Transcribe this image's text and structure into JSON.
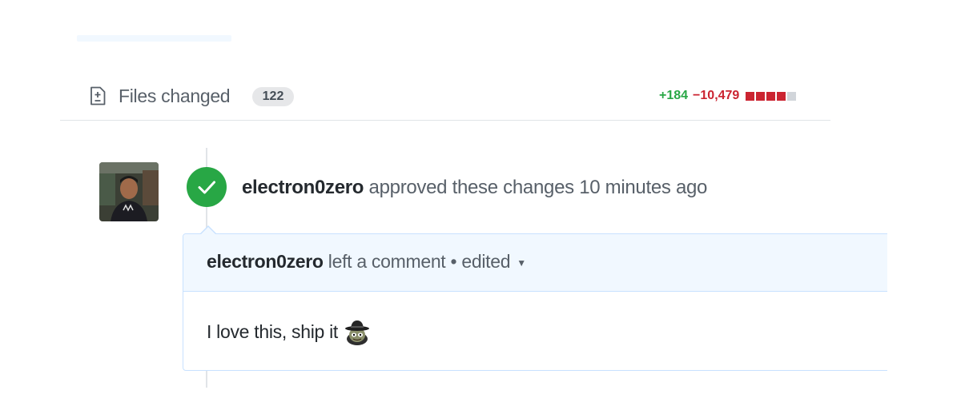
{
  "files_changed": {
    "label": "Files changed",
    "count": "122",
    "icon": "diff-file-icon"
  },
  "diffstat": {
    "additions": "+184",
    "deletions": "−10,479",
    "blocks": [
      "deleted",
      "deleted",
      "deleted",
      "deleted",
      "neutral"
    ],
    "colors": {
      "additions": "#28a745",
      "deletions": "#cb2431",
      "neutral": "#d1d5da"
    }
  },
  "review": {
    "author": "electron0zero",
    "action": "approved these changes",
    "time": "10 minutes ago",
    "status_icon": "check-icon",
    "status_color": "#28a745"
  },
  "comment": {
    "author": "electron0zero",
    "action": "left a comment",
    "separator": "•",
    "edited": "edited",
    "body": "I love this, ship it",
    "emoji": "shipit-emoji"
  }
}
